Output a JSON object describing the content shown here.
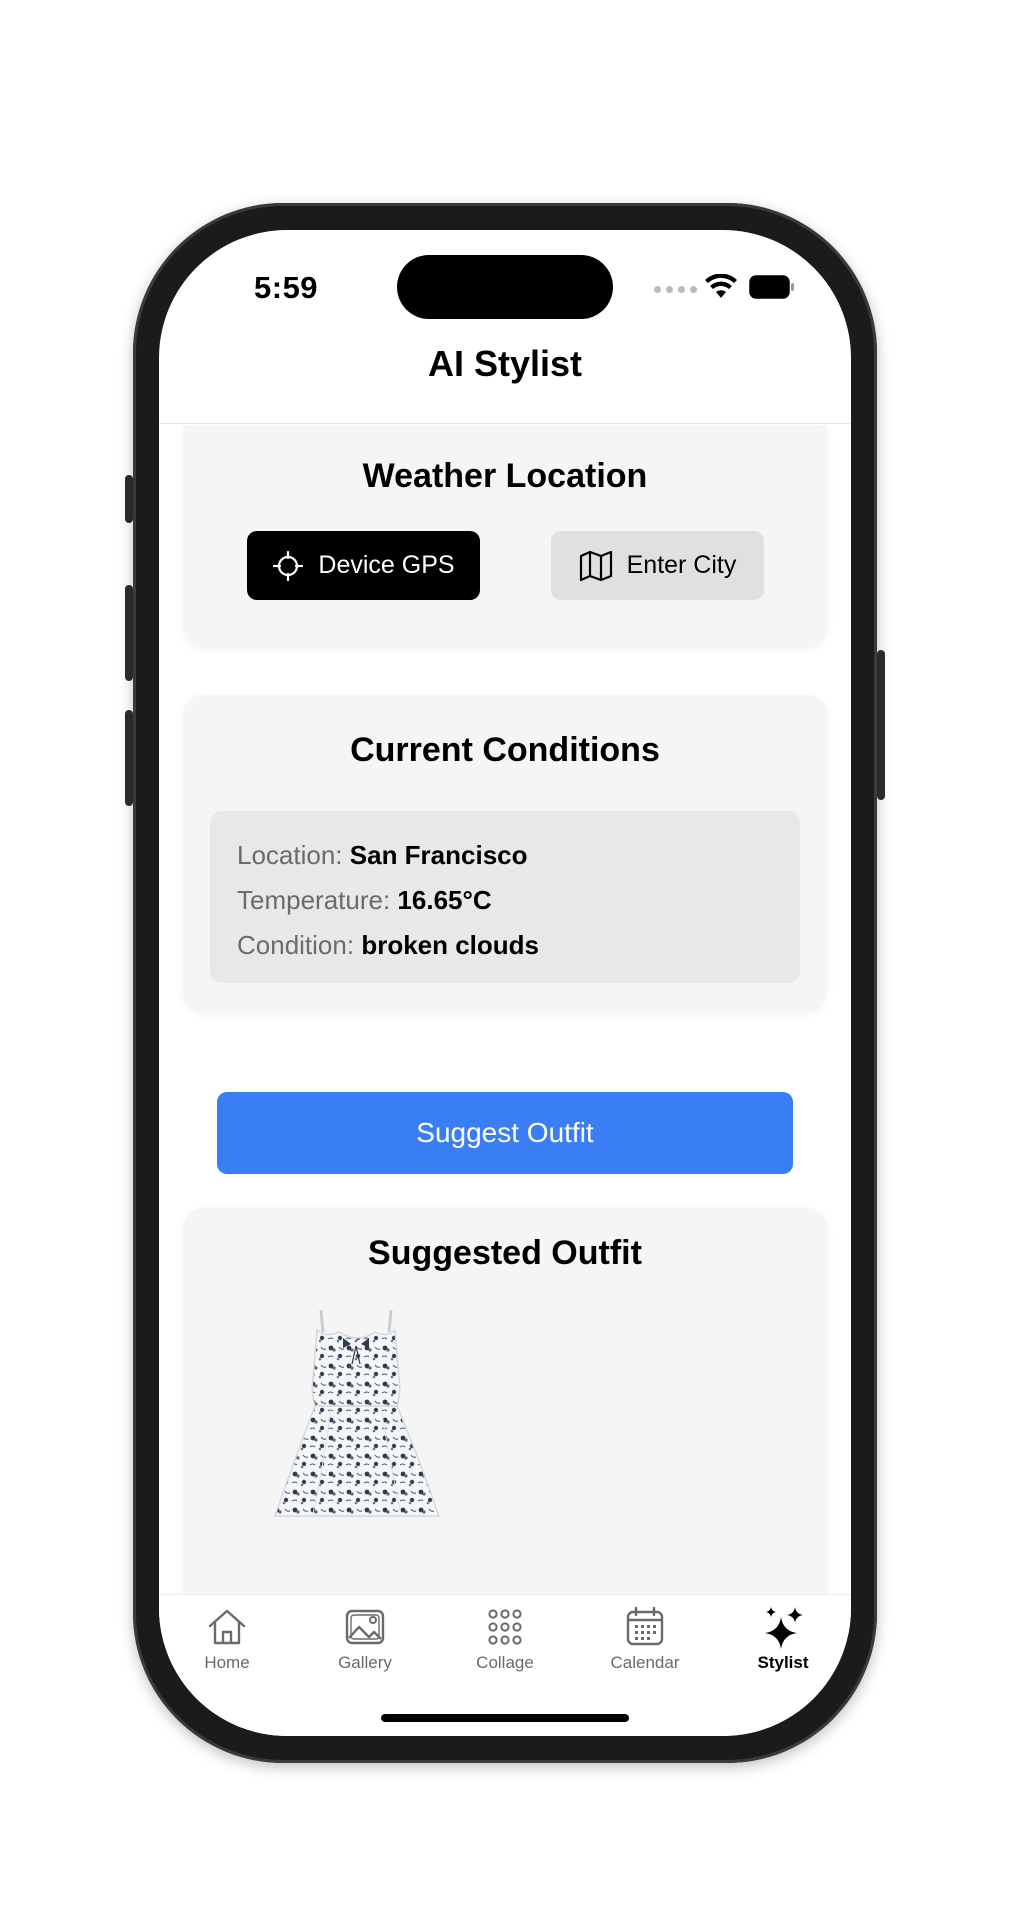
{
  "status_bar": {
    "time": "5:59"
  },
  "nav": {
    "title": "AI Stylist"
  },
  "weather_location": {
    "title": "Weather Location",
    "gps_button_label": "Device GPS",
    "city_button_label": "Enter City",
    "selected": "Device GPS"
  },
  "current_conditions": {
    "title": "Current Conditions",
    "rows": [
      {
        "label": "Location:",
        "value": "San Francisco"
      },
      {
        "label": "Temperature:",
        "value": "16.65°C"
      },
      {
        "label": "Condition:",
        "value": "broken clouds"
      }
    ]
  },
  "suggest_button": {
    "label": "Suggest Outfit",
    "color": "#3a7ef5"
  },
  "suggested_outfit": {
    "title": "Suggested Outfit",
    "items": [
      {
        "icon": "floral-dress-image"
      }
    ]
  },
  "tabbar": {
    "tabs": [
      {
        "label": "Home",
        "icon": "house-icon",
        "active": false
      },
      {
        "label": "Gallery",
        "icon": "photo-icon",
        "active": false
      },
      {
        "label": "Collage",
        "icon": "grid-dots-icon",
        "active": false
      },
      {
        "label": "Calendar",
        "icon": "calendar-icon",
        "active": false
      },
      {
        "label": "Stylist",
        "icon": "sparkles-icon",
        "active": true
      }
    ]
  }
}
